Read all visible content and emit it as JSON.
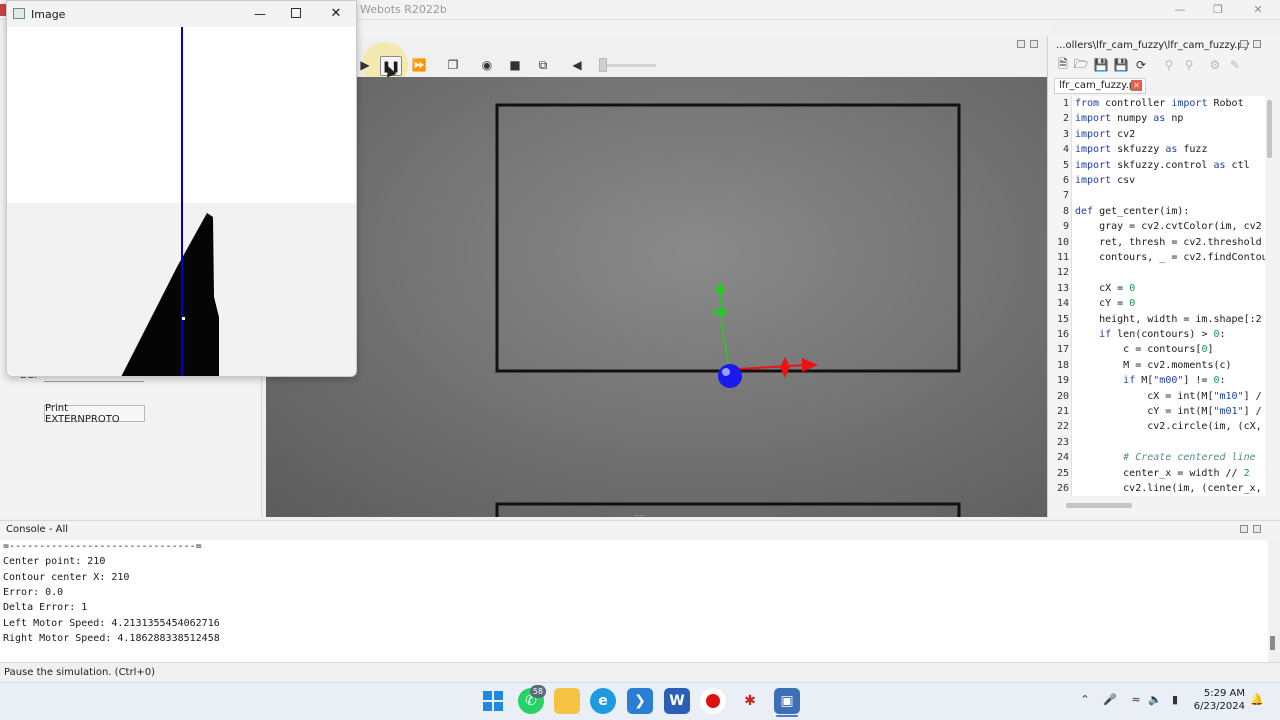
{
  "app": {
    "title": "Webots R2022b"
  },
  "image_window": {
    "title": "Image"
  },
  "left_panel": {
    "def_label": "DEF",
    "extern_button": "Print EXTERNPROTO"
  },
  "editor": {
    "path": "...ollers\\lfr_cam_fuzzy\\lfr_cam_fuzzy.py",
    "tab": "lfr_cam_fuzzy.py",
    "lines": [
      {
        "n": "1",
        "html": "<span class=\"kw\">from</span> controller <span class=\"kw\">import</span> Robot"
      },
      {
        "n": "2",
        "html": "<span class=\"kw\">import</span> numpy <span class=\"kw\">as</span> np"
      },
      {
        "n": "3",
        "html": "<span class=\"kw\">import</span> cv2"
      },
      {
        "n": "4",
        "html": "<span class=\"kw\">import</span> skfuzzy <span class=\"kw\">as</span> fuzz"
      },
      {
        "n": "5",
        "html": "<span class=\"kw\">import</span> skfuzzy.control <span class=\"kw\">as</span> ctl"
      },
      {
        "n": "6",
        "html": "<span class=\"kw\">import</span> csv"
      },
      {
        "n": "7",
        "html": ""
      },
      {
        "n": "8",
        "html": "<span class=\"kw\">def</span> get_center(im):"
      },
      {
        "n": "9",
        "html": "    gray = cv2.cvtColor(im, cv2"
      },
      {
        "n": "10",
        "html": "    ret, thresh = cv2.threshold"
      },
      {
        "n": "11",
        "html": "    contours, _ = cv2.findContou"
      },
      {
        "n": "12",
        "html": ""
      },
      {
        "n": "13",
        "html": "    cX = <span class=\"num\">0</span>"
      },
      {
        "n": "14",
        "html": "    cY = <span class=\"num\">0</span>"
      },
      {
        "n": "15",
        "html": "    height, width = im.shape[:2"
      },
      {
        "n": "16",
        "html": "    <span class=\"kw\">if</span> len(contours) > <span class=\"num\">0</span>:"
      },
      {
        "n": "17",
        "html": "        c = contours[<span class=\"num\">0</span>]"
      },
      {
        "n": "18",
        "html": "        M = cv2.moments(c)"
      },
      {
        "n": "19",
        "html": "        <span class=\"kw\">if</span> M[<span class=\"str\">\"m00\"</span>] != <span class=\"num\">0</span>:"
      },
      {
        "n": "20",
        "html": "            cX = int(M[<span class=\"str\">\"m10\"</span>] /"
      },
      {
        "n": "21",
        "html": "            cY = int(M[<span class=\"str\">\"m01\"</span>] /"
      },
      {
        "n": "22",
        "html": "            cv2.circle(im, (cX,"
      },
      {
        "n": "23",
        "html": ""
      },
      {
        "n": "24",
        "html": "        <span class=\"cmt\"># Create centered line</span>"
      },
      {
        "n": "25",
        "html": "        center_x = width // <span class=\"num\">2</span>"
      },
      {
        "n": "26",
        "html": "        cv2.line(im, (center_x,"
      }
    ]
  },
  "console": {
    "title": "Console - All",
    "lines": [
      "=-------------------------------=",
      "Center point: 210",
      "Contour center X: 210",
      "Error: 0.0",
      "Delta Error: 1",
      "Left Motor Speed: 4.2131355454062716",
      "Right Motor Speed: 4.186288338512458"
    ]
  },
  "status": {
    "text": "Pause the simulation. (Ctrl+0)"
  },
  "taskbar": {
    "whatsapp_badge": "58",
    "time": "5:29 AM",
    "date": "6/23/2024"
  },
  "colors": {
    "accent_blue": "#0000c8",
    "axis_green": "#22cc22",
    "axis_red": "#ee1111",
    "robot_blue": "#1a1aee"
  }
}
